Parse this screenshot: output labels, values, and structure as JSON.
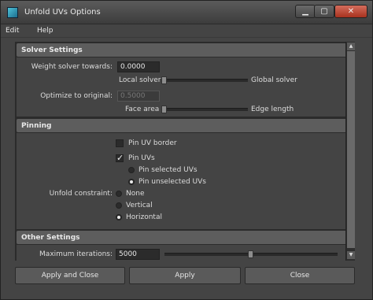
{
  "window": {
    "title": "Unfold UVs Options",
    "minimize_glyph": "▁",
    "maximize_glyph": "▢",
    "close_glyph": "✕"
  },
  "menubar": {
    "items": [
      "Edit",
      "Help"
    ]
  },
  "sections": {
    "solver": {
      "header": "Solver Settings",
      "weight_label": "Weight solver towards:",
      "weight_value": "0.0000",
      "weight_left": "Local solver",
      "weight_right": "Global solver",
      "weight_fraction": 0.0,
      "optimize_label": "Optimize to original:",
      "optimize_value": "0.5000",
      "optimize_left": "Face area",
      "optimize_right": "Edge length",
      "optimize_fraction": 0.0
    },
    "pinning": {
      "header": "Pinning",
      "pin_border": "Pin UV border",
      "pin_border_checked": false,
      "pin_uvs": "Pin UVs",
      "pin_uvs_checked": true,
      "pin_selected": "Pin selected UVs",
      "pin_selected_on": false,
      "pin_unselected": "Pin unselected UVs",
      "pin_unselected_on": true,
      "constraint_label": "Unfold constraint:",
      "constraint_none": "None",
      "constraint_vertical": "Vertical",
      "constraint_horizontal": "Horizontal",
      "constraint_selected": "Horizontal"
    },
    "other": {
      "header": "Other Settings",
      "max_iter_label": "Maximum iterations:",
      "max_iter_value": "5000",
      "max_iter_fraction": 0.5
    }
  },
  "buttons": {
    "apply_close": "Apply and Close",
    "apply": "Apply",
    "close": "Close"
  },
  "colors": {
    "window_bg": "#444444",
    "header_bg": "#5d5d5d",
    "field_bg": "#2b2b2b"
  }
}
